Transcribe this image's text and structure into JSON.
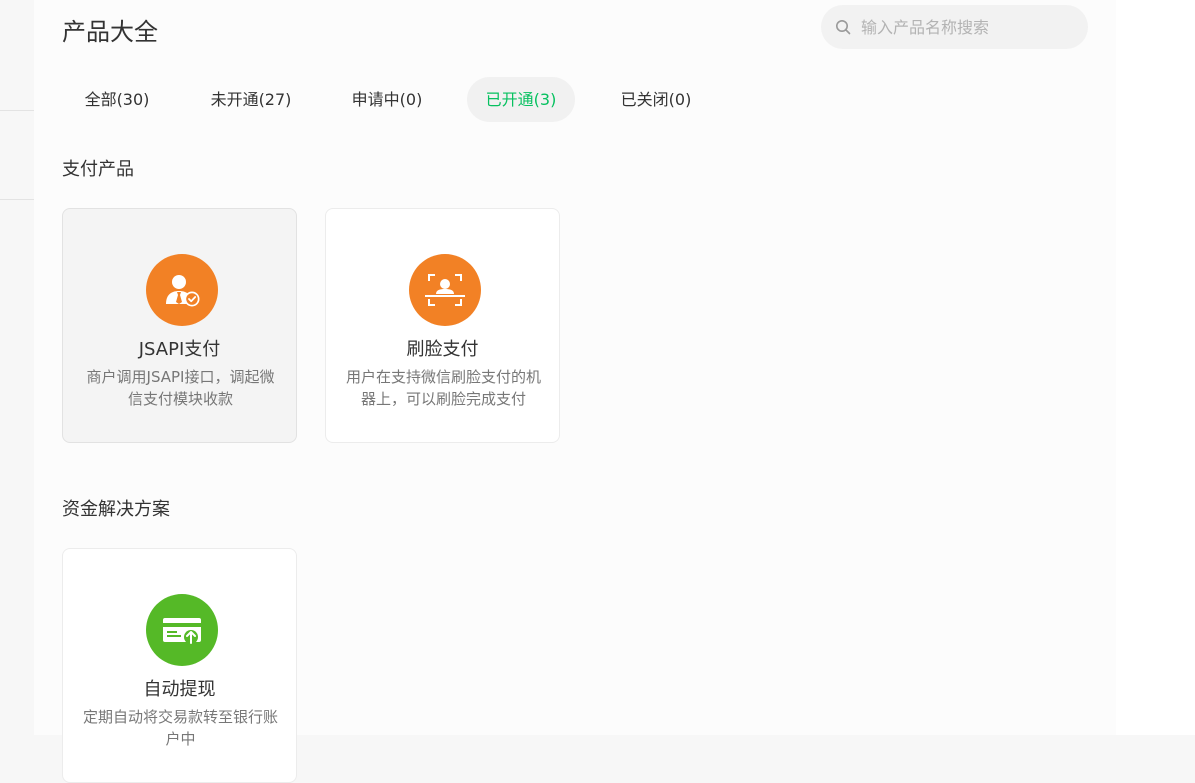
{
  "header": {
    "title": "产品大全"
  },
  "search": {
    "placeholder": "输入产品名称搜索"
  },
  "tabs": [
    {
      "label": "全部(30)",
      "active": false
    },
    {
      "label": "未开通(27)",
      "active": false
    },
    {
      "label": "申请中(0)",
      "active": false
    },
    {
      "label": "已开通(3)",
      "active": true
    },
    {
      "label": "已关闭(0)",
      "active": false
    }
  ],
  "sections": [
    {
      "title": "支付产品",
      "cards": [
        {
          "title": "JSAPI支付",
          "desc": "商户调用JSAPI接口，调起微信支付模块收款",
          "icon": "user-check-icon",
          "color": "#f28125"
        },
        {
          "title": "刷脸支付",
          "desc": "用户在支持微信刷脸支付的机器上，可以刷脸完成支付",
          "icon": "face-scan-icon",
          "color": "#f28125"
        }
      ]
    },
    {
      "title": "资金解决方案",
      "cards": [
        {
          "title": "自动提现",
          "desc": "定期自动将交易款转至银行账户中",
          "icon": "card-withdraw-icon",
          "color": "#55b927"
        }
      ]
    }
  ],
  "colors": {
    "accent": "#07c160",
    "orange": "#f28125",
    "green": "#55b927"
  }
}
